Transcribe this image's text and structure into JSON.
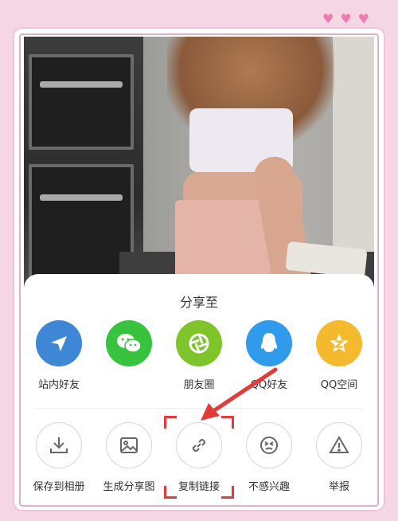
{
  "decor": {
    "hearts": [
      "♥",
      "♥",
      "♥"
    ]
  },
  "share_sheet": {
    "title": "分享至",
    "primary_row": [
      {
        "label": "站内好友",
        "icon": "send-arrow-icon",
        "color": "#3e86d6"
      },
      {
        "label": "",
        "icon": "wechat-icon",
        "color": "#38c33f"
      },
      {
        "label": "朋友圈",
        "icon": "moments-shutter-icon",
        "color": "#7fc42a"
      },
      {
        "label": "QQ好友",
        "icon": "qq-penguin-icon",
        "color": "#2f9bea"
      },
      {
        "label": "QQ空间",
        "icon": "qzone-star-icon",
        "color": "#f5b92d"
      }
    ],
    "secondary_row": [
      {
        "label": "保存到相册",
        "icon": "download-icon"
      },
      {
        "label": "生成分享图",
        "icon": "image-icon"
      },
      {
        "label": "复制链接",
        "icon": "link-icon"
      },
      {
        "label": "不感兴趣",
        "icon": "annoyed-face-icon"
      },
      {
        "label": "举报",
        "icon": "warning-triangle-icon"
      }
    ]
  },
  "annotation": {
    "highlight_color": "#e23b3b"
  }
}
